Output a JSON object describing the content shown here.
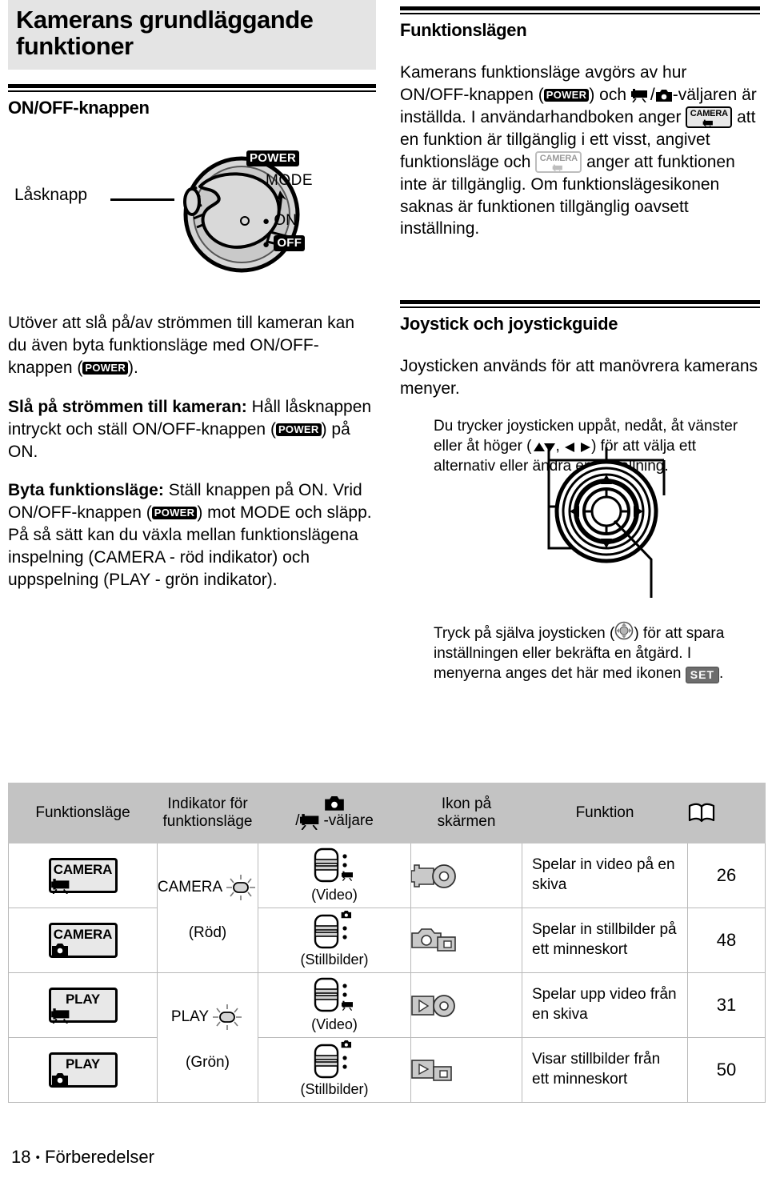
{
  "chapter": {
    "title": "Kamerans grundläggande funktioner"
  },
  "left": {
    "section_title": "ON/OFF-knappen",
    "dial": {
      "callout_label": "Låsknapp",
      "power_label": "POWER",
      "mode_label": "MODE",
      "on_label": "ON",
      "off_label": "OFF"
    },
    "para1_a": "Utöver att slå på/av strömmen till kameran kan du även byta funktionsläge med ON/OFF-knappen (",
    "para1_b": ").",
    "power_key": "POWER",
    "para2_bold": "Slå på strömmen till kameran:",
    "para2_a": " Håll låsknappen intryckt och ställ ON/OFF-knappen (",
    "para2_b": ") på ON.",
    "para3_bold": "Byta funktionsläge:",
    "para3_a": " Ställ knappen på ON. Vrid ON/OFF-knappen (",
    "para3_b": ") mot MODE och släpp. På så sätt kan du växla mellan funktionslägena inspelning (CAMERA - röd indikator) och uppspelning (PLAY - grön indikator)."
  },
  "right": {
    "section_title_1": "Funktionslägen",
    "modes_para_1": "Kamerans funktionsläge avgörs av hur ON/OFF-knappen (",
    "modes_para_2": ") och ",
    "modes_para_3": "-väljaren är inställda. I användarhandboken anger ",
    "modes_para_4": " att en funktion är tillgänglig i ett visst, angivet funktionsläge och ",
    "modes_para_5": " anger att funktionen inte är tillgänglig. Om funktionslägesikonen saknas är funktionen tillgänglig oavsett inställning.",
    "camera_chip_label": "CAMERA",
    "section_title_2": "Joystick och joystickguide",
    "joy_para_1": "Joysticken används för att manövrera kamerans menyer.",
    "joy_para_2_a": "Du trycker joysticken uppåt, nedåt, åt vänster eller åt höger (",
    "joy_para_2_b": ", ",
    "joy_para_2_c": ") för att välja ett alternativ eller ändra en inställning.",
    "joy_para_3_a": "Tryck på själva joysticken (",
    "joy_para_3_b": ") för att spara inställningen eller bekräfta en åtgärd. I menyerna anges det här med ikonen ",
    "set_key": "SET",
    "joy_para_3_c": "."
  },
  "table": {
    "headers": [
      "Funktionsläge",
      "Indikator för funktionsläge",
      "/ -väljare",
      "Ikon på skärmen",
      "Funktion",
      "book-icon"
    ],
    "header_selector_top_icon": "still-camera-icon",
    "header_selector_bottom_icon": "video-camera-icon",
    "rows": [
      {
        "mode_word": "CAMERA",
        "mode_glyph": "video-camera-icon",
        "indicator_name": "CAMERA",
        "indicator_color": "(Röd)",
        "selector_label": "(Video)",
        "screen_icon": "video-record-disc-icon",
        "function": "Spelar in video på en skiva",
        "page": "26"
      },
      {
        "mode_word": "CAMERA",
        "mode_glyph": "still-camera-icon",
        "indicator_name": "CAMERA",
        "indicator_color": "(Röd)",
        "selector_label": "(Stillbilder)",
        "screen_icon": "still-record-card-icon",
        "function": "Spelar in stillbilder på ett minneskort",
        "page": "48"
      },
      {
        "mode_word": "PLAY",
        "mode_glyph": "video-camera-icon",
        "indicator_name": "PLAY",
        "indicator_color": "(Grön)",
        "selector_label": "(Video)",
        "screen_icon": "video-play-disc-icon",
        "function": "Spelar upp video från en skiva",
        "page": "31"
      },
      {
        "mode_word": "PLAY",
        "mode_glyph": "still-camera-icon",
        "indicator_name": "PLAY",
        "indicator_color": "(Grön)",
        "selector_label": "(Stillbilder)",
        "screen_icon": "still-play-card-icon",
        "function": "Visar stillbilder från ett minneskort",
        "page": "50"
      }
    ]
  },
  "footer": {
    "page_number": "18",
    "separator": "•",
    "section": "Förberedelser"
  }
}
